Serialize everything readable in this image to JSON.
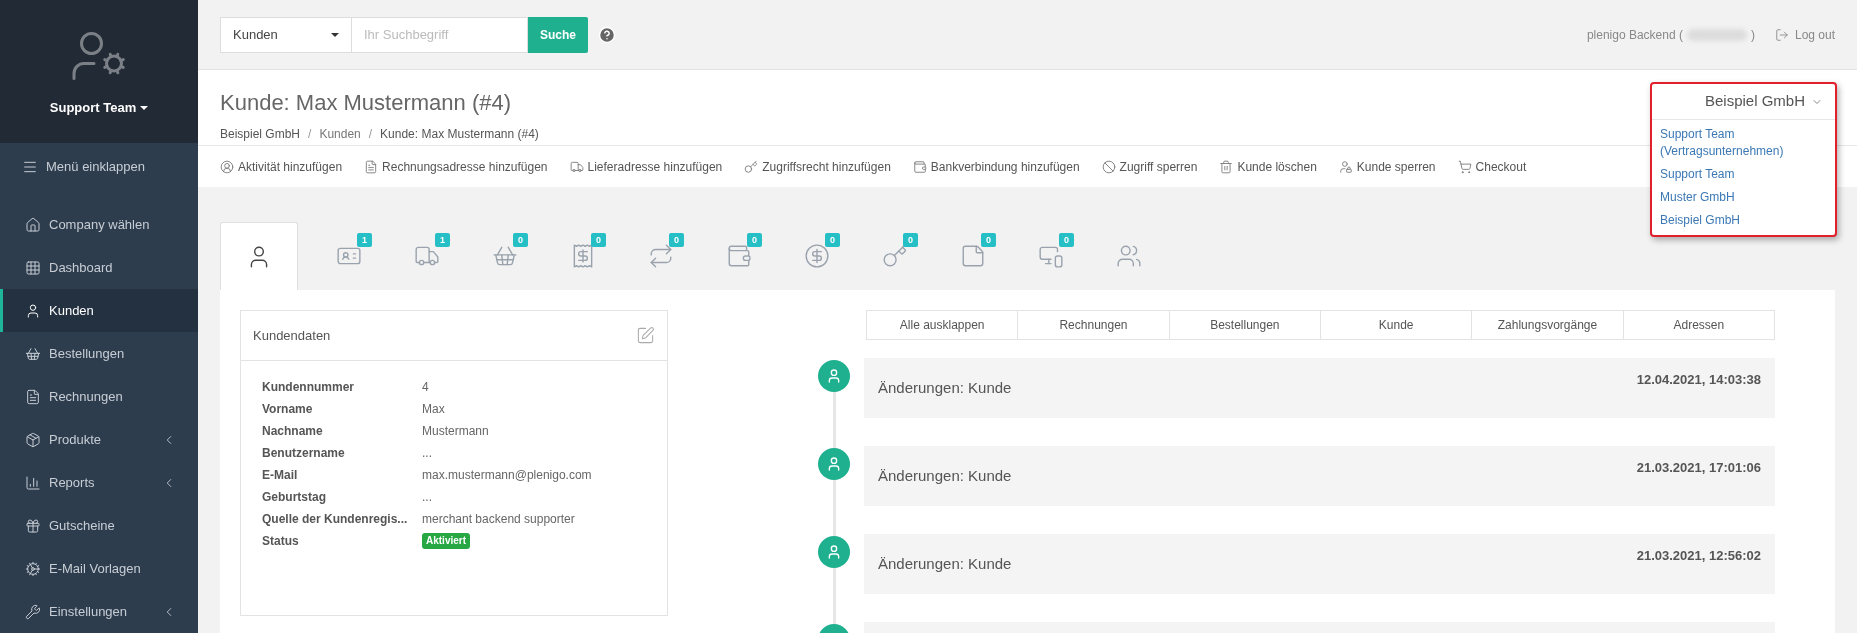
{
  "sidebar": {
    "team": "Support Team",
    "collapse": "Menü einklappen",
    "items": [
      {
        "label": "Company wählen",
        "selected": false,
        "expandable": false
      },
      {
        "label": "Dashboard",
        "selected": false,
        "expandable": false
      },
      {
        "label": "Kunden",
        "selected": true,
        "expandable": false
      },
      {
        "label": "Bestellungen",
        "selected": false,
        "expandable": false
      },
      {
        "label": "Rechnungen",
        "selected": false,
        "expandable": false
      },
      {
        "label": "Produkte",
        "selected": false,
        "expandable": true
      },
      {
        "label": "Reports",
        "selected": false,
        "expandable": true
      },
      {
        "label": "Gutscheine",
        "selected": false,
        "expandable": false
      },
      {
        "label": "E-Mail Vorlagen",
        "selected": false,
        "expandable": false
      },
      {
        "label": "Einstellungen",
        "selected": false,
        "expandable": true
      }
    ]
  },
  "topbar": {
    "search_scope": "Kunden",
    "search": {
      "placeholder": "Ihr Suchbegriff"
    },
    "search_button": "Suche",
    "user_prefix": "plenigo Backend (",
    "user_suffix": ")",
    "logout": "Log out"
  },
  "header": {
    "title": "Kunde: Max Mustermann (#4)",
    "breadcrumb_separator": "/",
    "breadcrumb": [
      "Beispiel GmbH",
      "Kunden",
      "Kunde: Max Mustermann (#4)"
    ],
    "company_menu": {
      "current": "Beispiel GmbH",
      "expanded": true,
      "options": [
        "Support Team (Vertragsunternehmen)",
        "Support Team",
        "Muster GmbH",
        "Beispiel GmbH"
      ]
    }
  },
  "actions": [
    "Aktivität hinzufügen",
    "Rechnungsadresse hinzufügen",
    "Lieferadresse hinzufügen",
    "Zugriffsrecht hinzufügen",
    "Bankverbindung hinzufügen",
    "Zugriff sperren",
    "Kunde löschen",
    "Kunde sperren",
    "Checkout"
  ],
  "tabs": [
    {
      "selected": true
    },
    {
      "selected": false,
      "badge": "1"
    },
    {
      "selected": false,
      "badge": "1"
    },
    {
      "selected": false,
      "badge": "0"
    },
    {
      "selected": false,
      "badge": "0"
    },
    {
      "selected": false,
      "badge": "0"
    },
    {
      "selected": false,
      "badge": "0"
    },
    {
      "selected": false,
      "badge": "0"
    },
    {
      "selected": false,
      "badge": "0"
    },
    {
      "selected": false,
      "badge": "0"
    },
    {
      "selected": false,
      "badge": "0"
    },
    {
      "selected": false
    }
  ],
  "customer_card": {
    "title": "Kundendaten",
    "fields": [
      {
        "label": "Kundennummer",
        "value": "4",
        "kind": "text"
      },
      {
        "label": "Vorname",
        "value": "Max",
        "kind": "text"
      },
      {
        "label": "Nachname",
        "value": "Mustermann",
        "kind": "text"
      },
      {
        "label": "Benutzername",
        "value": "...",
        "kind": "text"
      },
      {
        "label": "E-Mail",
        "value": "max.mustermann@plenigo.com",
        "kind": "text"
      },
      {
        "label": "Geburtstag",
        "value": "...",
        "kind": "text"
      },
      {
        "label": "Quelle der Kundenregis...",
        "value": "merchant backend supporter",
        "kind": "text"
      },
      {
        "label": "Status",
        "value": "Aktiviert",
        "kind": "badge"
      }
    ]
  },
  "timeline": {
    "filters": [
      "Alle ausklappen",
      "Rechnungen",
      "Bestellungen",
      "Kunde",
      "Zahlungsvorgänge",
      "Adressen"
    ],
    "entries": [
      {
        "title": "Änderungen: Kunde",
        "date": "12.04.2021, 14:03:38"
      },
      {
        "title": "Änderungen: Kunde",
        "date": "21.03.2021, 17:01:06"
      },
      {
        "title": "Änderungen: Kunde",
        "date": "21.03.2021, 12:56:02"
      }
    ]
  }
}
